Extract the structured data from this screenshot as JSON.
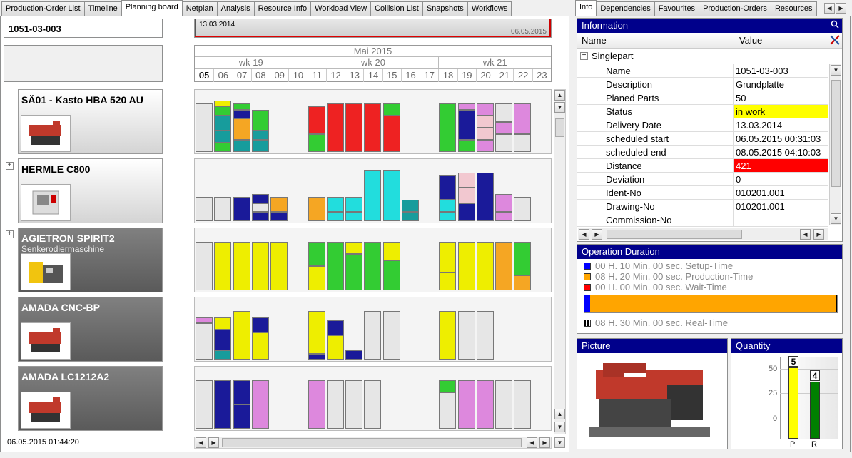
{
  "left_tabs": [
    "Production-Order List",
    "Timeline",
    "Planning board",
    "Netplan",
    "Analysis",
    "Resource Info",
    "Workload View",
    "Collision List",
    "Snapshots",
    "Workflows"
  ],
  "right_tabs": [
    "Info",
    "Dependencies",
    "Favourites",
    "Production-Orders",
    "Resources"
  ],
  "order_field": "1051-03-003",
  "timeline": {
    "start": "13.03.2014",
    "end": "06.05.2015"
  },
  "calendar": {
    "month": "Mai 2015",
    "weeks": [
      "wk 19",
      "wk 20",
      "wk 21"
    ],
    "days": [
      "05",
      "06",
      "07",
      "08",
      "09",
      "10",
      "11",
      "12",
      "13",
      "14",
      "15",
      "16",
      "17",
      "18",
      "19",
      "20",
      "21",
      "22",
      "23"
    ]
  },
  "machines": [
    {
      "name": "SÄ01 - Kasto  HBA 520 AU",
      "sub": ""
    },
    {
      "name": "HERMLE C800",
      "sub": ""
    },
    {
      "name": "AGIETRON SPIRIT2",
      "sub": "Senkerodiermaschine"
    },
    {
      "name": "AMADA CNC-BP",
      "sub": ""
    },
    {
      "name": "AMADA LC1212A2",
      "sub": ""
    }
  ],
  "status_time": "06.05.2015 01:44:20",
  "info": {
    "header": "Information",
    "col_name": "Name",
    "col_value": "Value",
    "group": "Singlepart",
    "rows": [
      {
        "k": "Name",
        "v": "1051-03-003",
        "bg": ""
      },
      {
        "k": "Description",
        "v": "Grundplatte",
        "bg": ""
      },
      {
        "k": "Planed Parts",
        "v": "50",
        "bg": ""
      },
      {
        "k": "Status",
        "v": "in work",
        "bg": "#ffff00"
      },
      {
        "k": "Delivery Date",
        "v": "13.03.2014",
        "bg": ""
      },
      {
        "k": "scheduled start",
        "v": "06.05.2015 00:31:03",
        "bg": ""
      },
      {
        "k": "scheduled end",
        "v": "08.05.2015 04:10:03",
        "bg": ""
      },
      {
        "k": "Distance",
        "v": "421",
        "bg": "#ff0000"
      },
      {
        "k": "Deviation",
        "v": "0",
        "bg": ""
      },
      {
        "k": "Ident-No",
        "v": "010201.001",
        "bg": ""
      },
      {
        "k": "Drawing-No",
        "v": "010201.001",
        "bg": ""
      },
      {
        "k": "Commission-No",
        "v": "",
        "bg": ""
      }
    ]
  },
  "duration": {
    "header": "Operation Duration",
    "items": [
      {
        "text": "00 H. 10 Min. 00 sec. Setup-Time",
        "color": "#0000ff"
      },
      {
        "text": "08 H. 20 Min. 00 sec. Production-Time",
        "color": "#ffa500"
      },
      {
        "text": "00 H. 00 Min. 00 sec. Wait-Time",
        "color": "#ff0000"
      }
    ],
    "real": "08 H. 30 Min. 00 sec. Real-Time"
  },
  "picture": {
    "header": "Picture"
  },
  "quantity": {
    "header": "Quantity",
    "ticks": [
      "50",
      "25",
      "0"
    ],
    "bars": [
      {
        "label": "P",
        "value": 5,
        "value_label": "5",
        "fill": 1.0,
        "color": "#ffff00"
      },
      {
        "label": "R",
        "value": 4,
        "value_label": "4",
        "fill": 0.8,
        "color": "#008000"
      }
    ]
  }
}
